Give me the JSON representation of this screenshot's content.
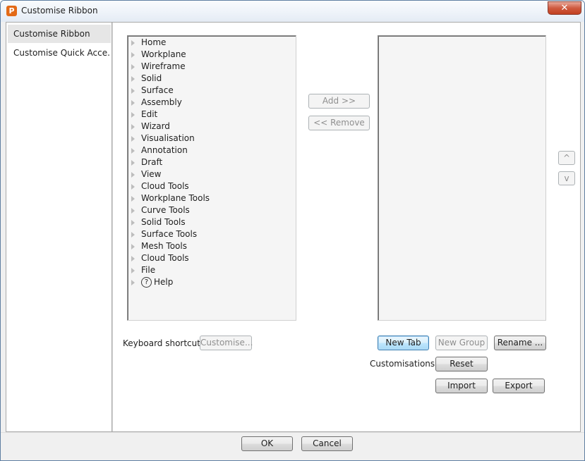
{
  "window": {
    "title": "Customise Ribbon",
    "close_glyph": "✕"
  },
  "sidebar": {
    "items": [
      {
        "label": "Customise Ribbon"
      },
      {
        "label": "Customise Quick Acce..."
      }
    ]
  },
  "tree": {
    "items": [
      {
        "label": "Home"
      },
      {
        "label": "Workplane"
      },
      {
        "label": "Wireframe"
      },
      {
        "label": "Solid"
      },
      {
        "label": "Surface"
      },
      {
        "label": "Assembly"
      },
      {
        "label": "Edit"
      },
      {
        "label": "Wizard"
      },
      {
        "label": "Visualisation"
      },
      {
        "label": "Annotation"
      },
      {
        "label": "Draft"
      },
      {
        "label": "View"
      },
      {
        "label": "Cloud Tools"
      },
      {
        "label": "Workplane Tools"
      },
      {
        "label": "Curve Tools"
      },
      {
        "label": "Solid Tools"
      },
      {
        "label": "Surface Tools"
      },
      {
        "label": "Mesh Tools"
      },
      {
        "label": "Cloud Tools"
      },
      {
        "label": "File"
      },
      {
        "label": "Help"
      }
    ],
    "help_icon_glyph": "?"
  },
  "transfer": {
    "add_label": "Add >>",
    "remove_label": "<< Remove"
  },
  "order": {
    "up_label": "^",
    "down_label": "v"
  },
  "shortcuts": {
    "label": "Keyboard shortcuts:",
    "customise_label": "Customise..."
  },
  "ribbon_actions": {
    "new_tab_label": "New Tab",
    "new_group_label": "New Group",
    "rename_label": "Rename ..."
  },
  "customisations": {
    "label": "Customisations:",
    "reset_label": "Reset",
    "import_label": "Import",
    "export_label": "Export"
  },
  "footer": {
    "ok_label": "OK",
    "cancel_label": "Cancel"
  },
  "colors": {
    "title_bar": "#eef3f9",
    "close_button": "#c9472b",
    "default_button": "#3c7fb1",
    "app_icon": "#e36a17"
  }
}
